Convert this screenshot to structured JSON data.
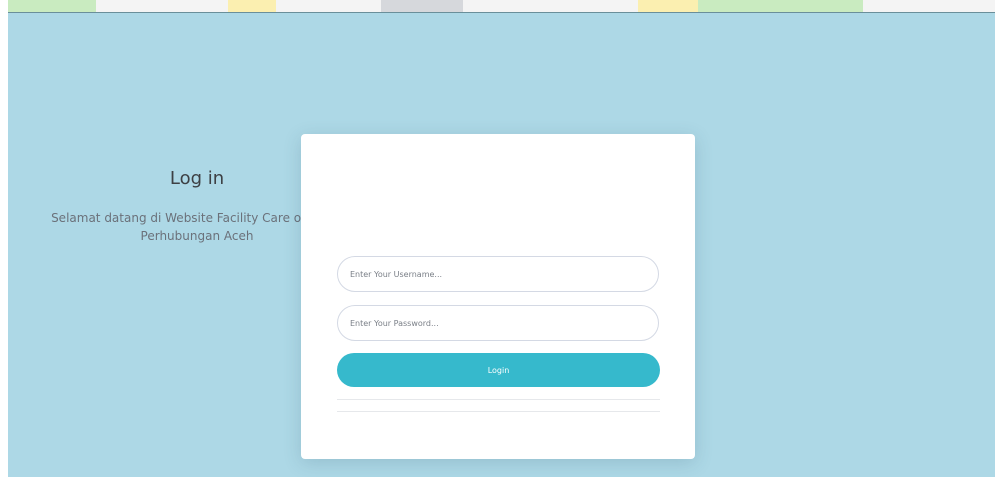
{
  "login": {
    "title": "Log in",
    "subtitle": "Selamat datang di Website Facility Care of Dinas Perhubungan Aceh",
    "username_placeholder": "Enter Your Username...",
    "password_placeholder": "Enter Your Password...",
    "button_label": "Login"
  },
  "colors": {
    "page_background": "#add8e6",
    "card_background": "#ffffff",
    "button_accent": "#36b9cc"
  }
}
